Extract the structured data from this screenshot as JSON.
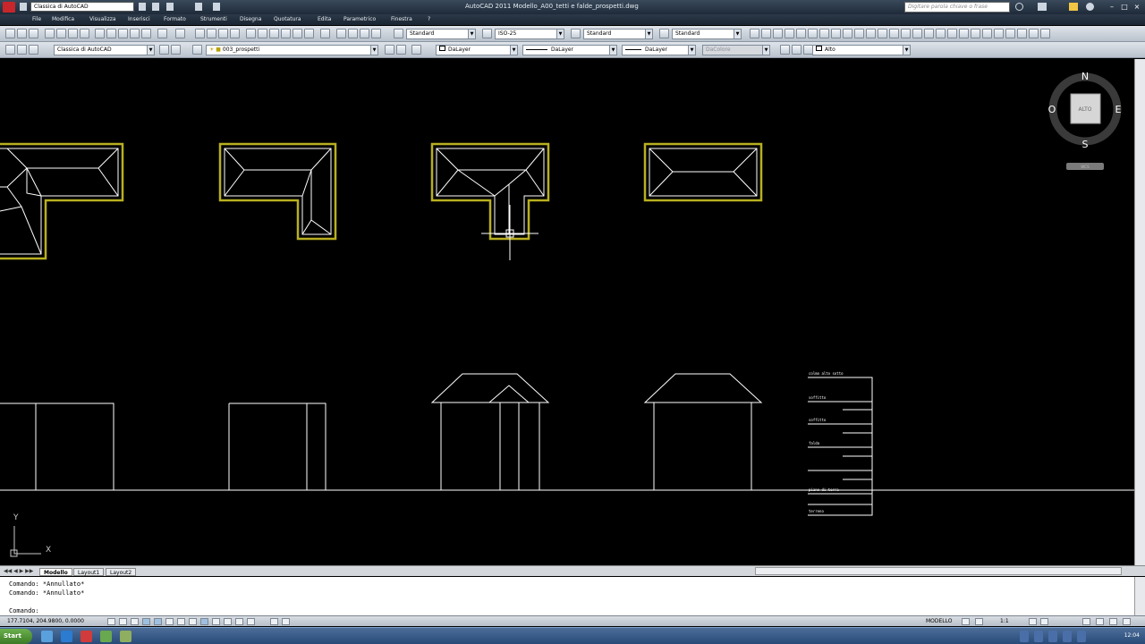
{
  "window": {
    "title": "AutoCAD 2011   Modello_A00_tetti e falde_prospetti.dwg",
    "workspace": "Classica di AutoCAD",
    "search_placeholder": "Digitare parola chiave o frase"
  },
  "menu": [
    "File",
    "Modifica",
    "Visualizza",
    "Inserisci",
    "Formato",
    "Strumenti",
    "Disegna",
    "Quotatura",
    "Edita",
    "Parametrico",
    "Finestra",
    "?"
  ],
  "toolbar1": {
    "text_style": "Standard",
    "dim_style": "ISO-25",
    "table_style": "Standard",
    "mleader_style": "Standard"
  },
  "toolbar2": {
    "workspace": "Classica di AutoCAD",
    "layer": "003_prospetti",
    "color": "DaLayer",
    "linetype": "DaLayer",
    "lineweight": "DaLayer",
    "plotstyle": "DaColore",
    "named_view": "Alto"
  },
  "viewcube": {
    "north": "N",
    "south": "S",
    "east": "E",
    "west": "O",
    "face": "ALTO",
    "wcs": "WCS"
  },
  "ucs": {
    "x": "X",
    "y": "Y"
  },
  "level_labels": [
    "colmo alto sotto",
    "soffitto",
    "soffitto",
    "falda",
    "piano di terra",
    "terreno"
  ],
  "tabs": [
    "Modello",
    "Layout1",
    "Layout2"
  ],
  "command_history": [
    "Comando: *Annullato*",
    "Comando: *Annullato*",
    "",
    "Comando:"
  ],
  "status": {
    "coordinates": "177.7104, 204.9800, 0.0000",
    "space": "MODELLO",
    "scale": "1:1",
    "clock": "12:04"
  },
  "taskbar": {
    "start": "Start"
  },
  "colors": {
    "roof_outline": "#b8b020",
    "lines": "#ffffff",
    "background": "#000000"
  }
}
